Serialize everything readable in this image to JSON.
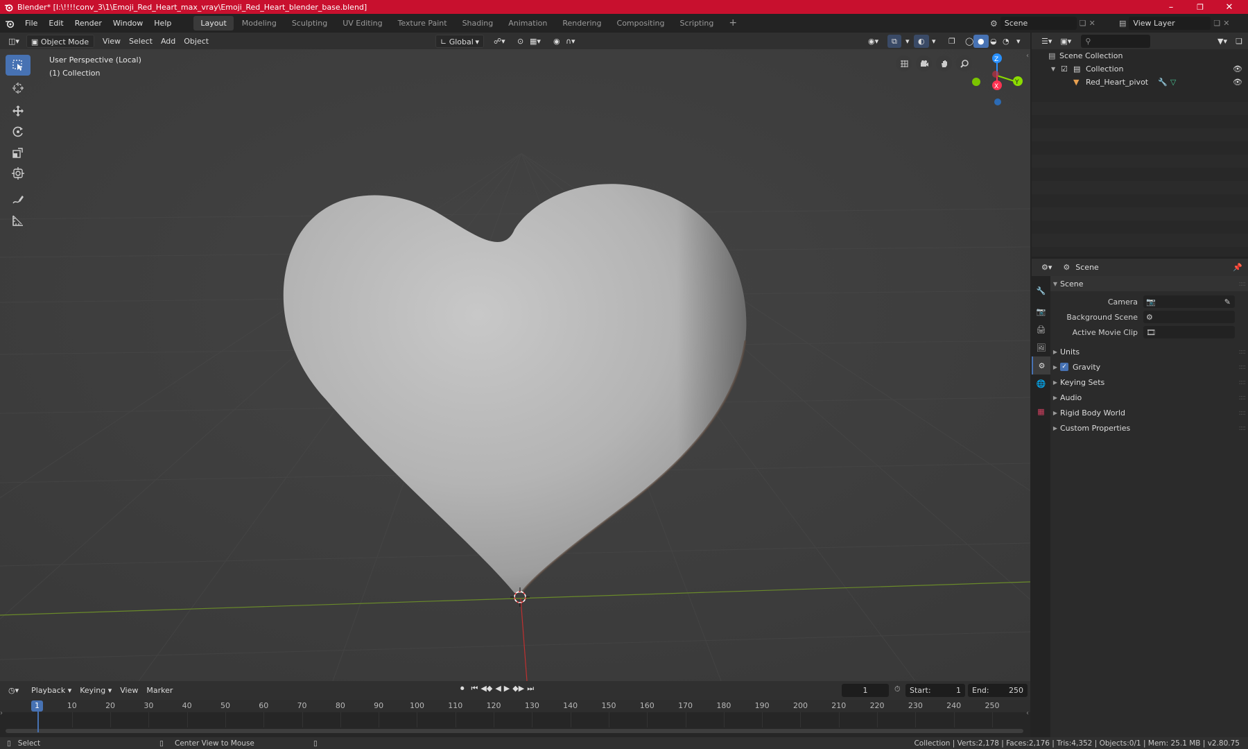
{
  "window": {
    "title": "Blender* [I:\\!!!!conv_3\\1\\Emoji_Red_Heart_max_vray\\Emoji_Red_Heart_blender_base.blend]",
    "minimize": "–",
    "maximize": "❒",
    "close": "✕"
  },
  "menu": {
    "items": [
      "File",
      "Edit",
      "Render",
      "Window",
      "Help"
    ]
  },
  "workspaces": [
    "Layout",
    "Modeling",
    "Sculpting",
    "UV Editing",
    "Texture Paint",
    "Shading",
    "Animation",
    "Rendering",
    "Compositing",
    "Scripting"
  ],
  "add_workspace": "+",
  "scene_selector": {
    "value": "Scene"
  },
  "view_layer_selector": {
    "value": "View Layer"
  },
  "viewport_header": {
    "mode": "Object Mode",
    "menus": [
      "View",
      "Select",
      "Add",
      "Object"
    ],
    "transform_orientation": "Global"
  },
  "viewport": {
    "perspective_label": "User Perspective (Local)",
    "collection_label": "(1) Collection",
    "gizmo_axes": {
      "z": "Z",
      "y": "Y",
      "x": "X"
    }
  },
  "outliner": {
    "root": "Scene Collection",
    "collection": "Collection",
    "object": "Red_Heart_pivot"
  },
  "properties": {
    "header_title": "Scene",
    "panel_title": "Scene",
    "fields": [
      {
        "label": "Camera"
      },
      {
        "label": "Background Scene"
      },
      {
        "label": "Active Movie Clip"
      }
    ],
    "sections": [
      "Units",
      "Gravity",
      "Keying Sets",
      "Audio",
      "Rigid Body World",
      "Custom Properties"
    ],
    "gravity_enabled": true
  },
  "timeline": {
    "menus": [
      "Playback",
      "Keying",
      "View",
      "Marker"
    ],
    "current_frame": "1",
    "start_label": "Start:",
    "start": "1",
    "end_label": "End:",
    "end": "250",
    "ruler": [
      "10",
      "20",
      "30",
      "40",
      "50",
      "60",
      "70",
      "80",
      "90",
      "100",
      "110",
      "120",
      "130",
      "140",
      "150",
      "160",
      "170",
      "180",
      "190",
      "200",
      "210",
      "220",
      "230",
      "240",
      "250"
    ],
    "playhead": "1"
  },
  "statusbar": {
    "left_action": "Select",
    "middle_action": "Center View to Mouse",
    "stats": "Collection | Verts:2,178 | Faces:2,176 | Tris:4,352 | Objects:0/1 | Mem: 25.1 MB | v2.80.75"
  },
  "colors": {
    "titlebar": "#c8102e",
    "accent": "#4772b3",
    "x_axis": "#ff3352",
    "y_axis": "#8bdc00",
    "z_axis": "#2890ff"
  }
}
